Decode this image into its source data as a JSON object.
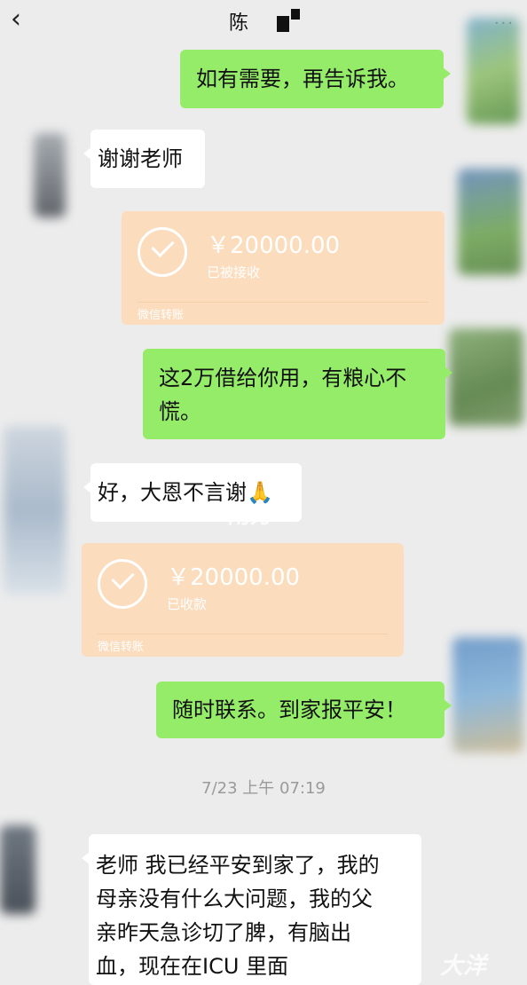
{
  "header": {
    "back_icon": "chevron-left-icon",
    "back_glyph": "‹",
    "title": "陈",
    "menu_glyph": "···"
  },
  "messages": {
    "m1": "如有需要，再告诉我。",
    "m2": "谢谢老师",
    "t1": {
      "amount": "￥20000.00",
      "status": "已被接收",
      "footer": "微信转账"
    },
    "m3_line1": "这2万借给你用，有粮心不",
    "m3_line2": "慌。",
    "m4": "好，大恩不言谢🙏",
    "t2": {
      "amount": "￥20000.00",
      "status": "已收款",
      "footer": "微信转账"
    },
    "m5": "随时联系。到家报平安！",
    "timestamp": "7/23 上午 07:19",
    "m6_line1": "老师 我已经平安到家了，我的",
    "m6_line2": "母亲没有什么大问题，我的父",
    "m6_line3": "亲昨天急诊切了脾，有脑出",
    "m6_line4": "血，现在在ICU 里面"
  },
  "watermark": {
    "mid": "南方",
    "bottom": "大洋"
  },
  "colors": {
    "background": "#ececec",
    "sent_bubble": "#95ec69",
    "received_bubble": "#ffffff",
    "transfer_card": "#fbdcbd"
  }
}
